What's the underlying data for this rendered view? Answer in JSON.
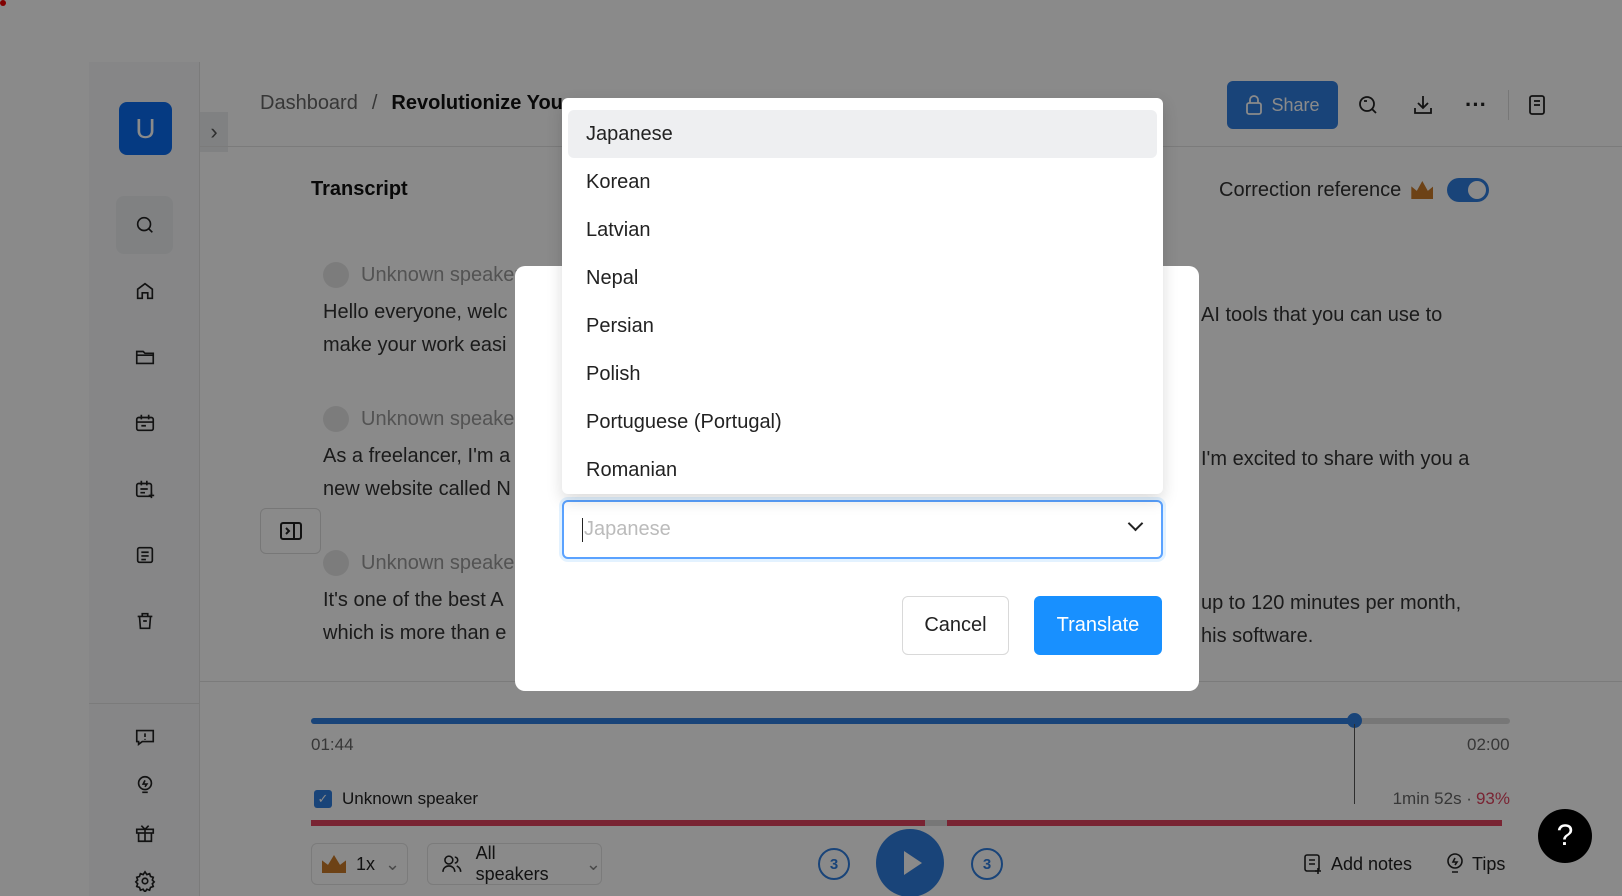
{
  "sidebar": {
    "avatar_letter": "U",
    "items": [
      "search-icon",
      "home-icon",
      "folder-icon",
      "calendar-icon",
      "calendar-add-icon",
      "list-icon",
      "trash-icon"
    ],
    "bottom_items": [
      "feedback-icon",
      "lightbulb-icon",
      "gift-icon",
      "gear-icon"
    ]
  },
  "header": {
    "breadcrumb_root": "Dashboard",
    "breadcrumb_sep": "/",
    "breadcrumb_current": "Revolutionize You",
    "share_label": "Share"
  },
  "transcript": {
    "title": "Transcript",
    "correction_label": "Correction reference",
    "correction_enabled": true,
    "segments": [
      {
        "speaker": "Unknown speaker",
        "line1_left": "Hello everyone, welc",
        "line1_right": "AI tools that you can use to",
        "line2_left": "make your work easi",
        "line2_right": ""
      },
      {
        "speaker": "Unknown speaker",
        "line1_left": "As a freelancer, I'm a",
        "line1_right": "I'm excited to share with you a",
        "line2_left": "new website called N",
        "line2_right": ""
      },
      {
        "speaker": "Unknown speaker",
        "line1_left": "It's one of the best A",
        "line1_right": "up to 120 minutes per month,",
        "line2_left": "which is more than e",
        "line2_right": "his software."
      }
    ]
  },
  "player": {
    "current_time": "01:44",
    "end_time": "02:00",
    "progress_percent": 87,
    "speaker_label": "Unknown speaker",
    "speaker_checked": true,
    "speaker_duration": "1min 52s ·",
    "speaker_percent": "93%",
    "speed": "1x",
    "speakers_filter": "All speakers",
    "rewind_seconds": "3",
    "forward_seconds": "3",
    "add_notes": "Add notes",
    "tips": "Tips",
    "help": "?"
  },
  "modal": {
    "options": [
      "Japanese",
      "Korean",
      "Latvian",
      "Nepal",
      "Persian",
      "Polish",
      "Portuguese (Portugal)",
      "Romanian"
    ],
    "selected": "Japanese",
    "input_placeholder": "Japanese",
    "cancel_label": "Cancel",
    "translate_label": "Translate"
  },
  "colors": {
    "accent": "#1890ff",
    "share": "#2f7ee0",
    "progress": "#2f7ee0",
    "speaker_bar": "#e0445f"
  }
}
